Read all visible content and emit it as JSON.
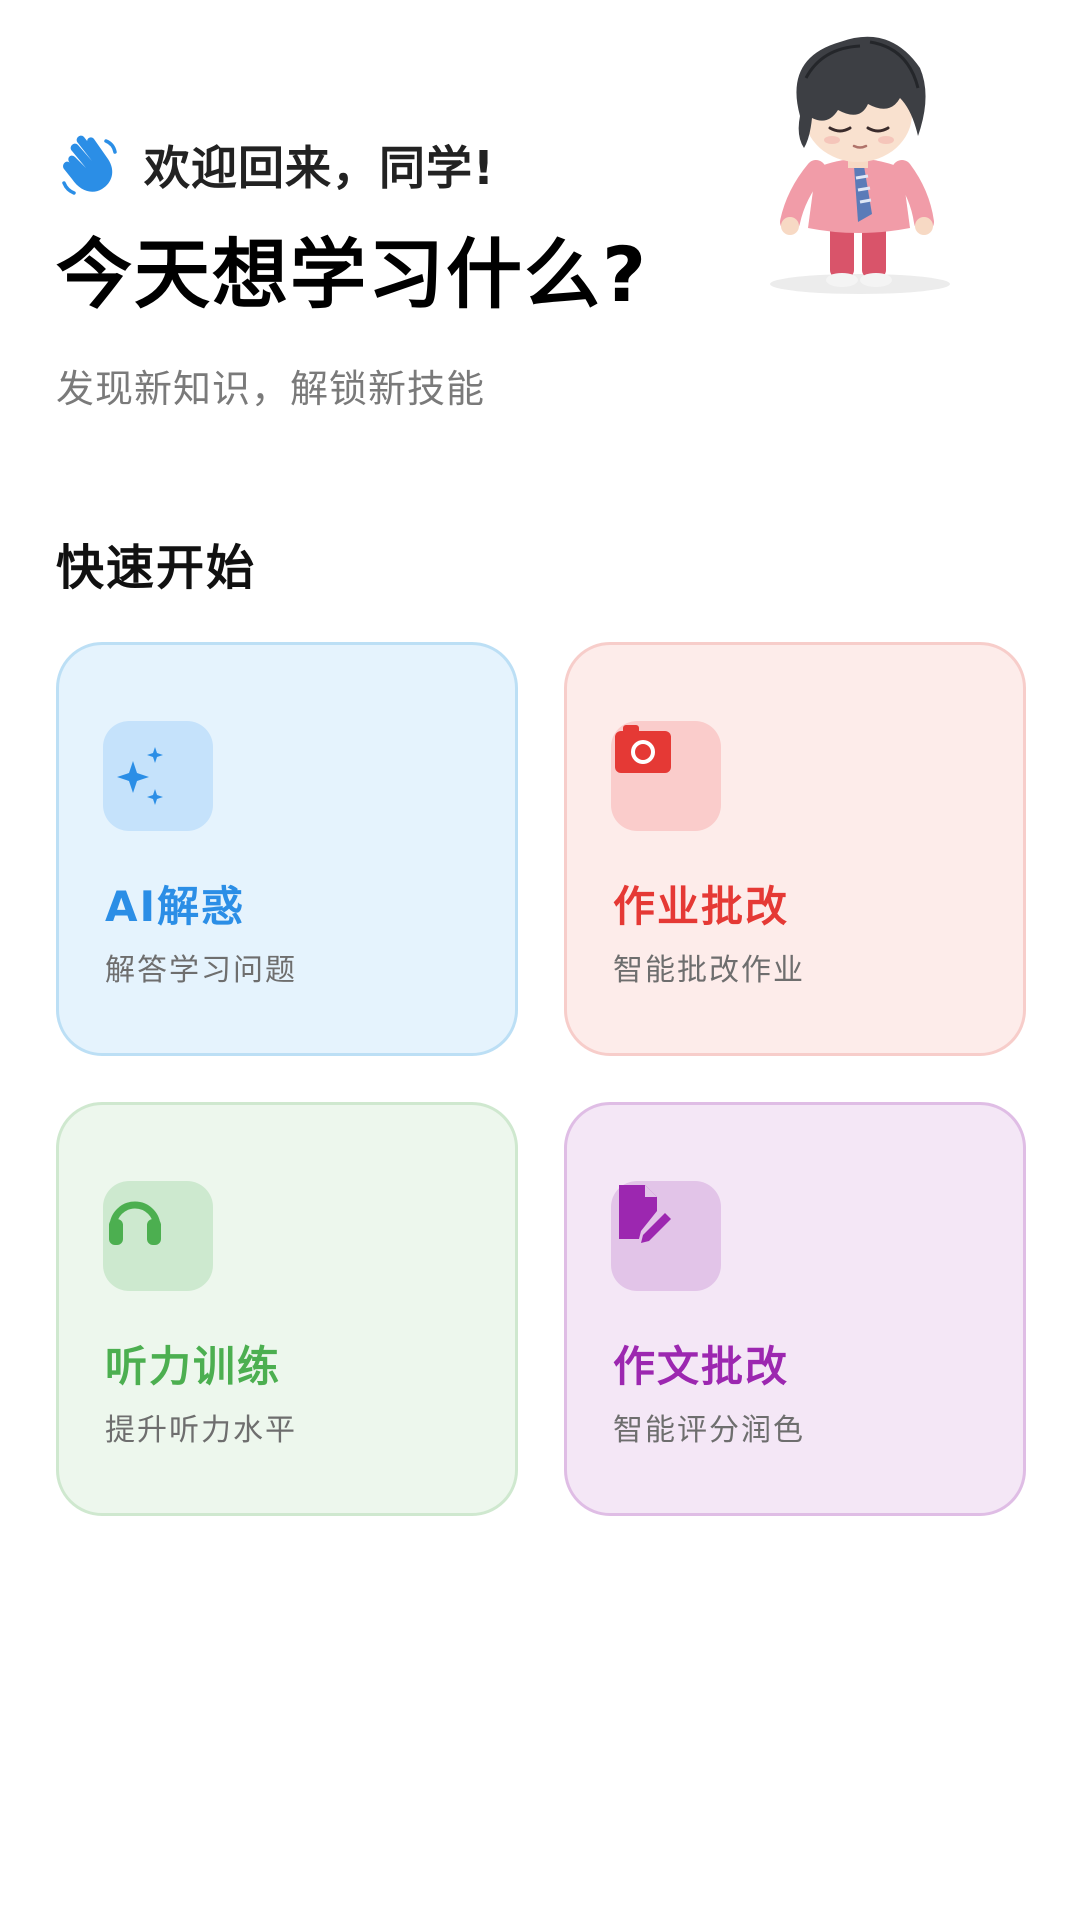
{
  "header": {
    "greeting": "欢迎回来，同学!",
    "headline": "今天想学习什么?",
    "subtitle": "发现新知识，解锁新技能",
    "wave_icon": "waving-hand-icon",
    "mascot": "cartoon-student-mascot"
  },
  "quick_start": {
    "title": "快速开始",
    "cards": [
      {
        "title": "AI解惑",
        "desc": "解答学习问题",
        "icon": "sparkles-icon",
        "accent": "#2b8ee6",
        "bg": "#e5f3fd"
      },
      {
        "title": "作业批改",
        "desc": "智能批改作业",
        "icon": "camera-icon",
        "accent": "#e53935",
        "bg": "#fdecea"
      },
      {
        "title": "听力训练",
        "desc": "提升听力水平",
        "icon": "headphones-icon",
        "accent": "#4caf50",
        "bg": "#edf7ed"
      },
      {
        "title": "作文批改",
        "desc": "智能评分润色",
        "icon": "edit-document-icon",
        "accent": "#9c27b0",
        "bg": "#f4e7f6"
      }
    ]
  }
}
